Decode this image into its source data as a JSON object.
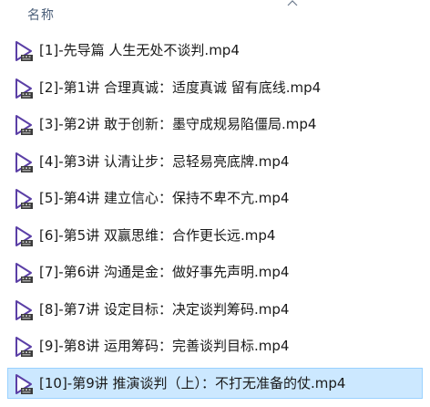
{
  "header": {
    "name_label": "名称",
    "sort_icon": "chevron-up-icon"
  },
  "files": [
    {
      "name": "[1]-先导篇 人生无处不谈判.mp4",
      "icon": "video-file-icon",
      "selected": false
    },
    {
      "name": "[2]-第1讲 合理真诚：适度真诚 留有底线.mp4",
      "icon": "video-file-icon",
      "selected": false
    },
    {
      "name": "[3]-第2讲 敢于创新：墨守成规易陷僵局.mp4",
      "icon": "video-file-icon",
      "selected": false
    },
    {
      "name": "[4]-第3讲 认清让步：忌轻易亮底牌.mp4",
      "icon": "video-file-icon",
      "selected": false
    },
    {
      "name": "[5]-第4讲 建立信心：保持不卑不亢.mp4",
      "icon": "video-file-icon",
      "selected": false
    },
    {
      "name": "[6]-第5讲 双赢思维：合作更长远.mp4",
      "icon": "video-file-icon",
      "selected": false
    },
    {
      "name": "[7]-第6讲 沟通是金：做好事先声明.mp4",
      "icon": "video-file-icon",
      "selected": false
    },
    {
      "name": "[8]-第7讲 设定目标：决定谈判筹码.mp4",
      "icon": "video-file-icon",
      "selected": false
    },
    {
      "name": "[9]-第8讲 运用筹码：完善谈判目标.mp4",
      "icon": "video-file-icon",
      "selected": false
    },
    {
      "name": "[10]-第9讲 推演谈判（上）：不打无准备的仗.mp4",
      "icon": "video-file-icon",
      "selected": true
    }
  ],
  "colors": {
    "header_text": "#4c607a",
    "icon_accent": "#5b3fa6",
    "selection_bg": "#cce8ff",
    "selection_border": "#99d1ff"
  }
}
